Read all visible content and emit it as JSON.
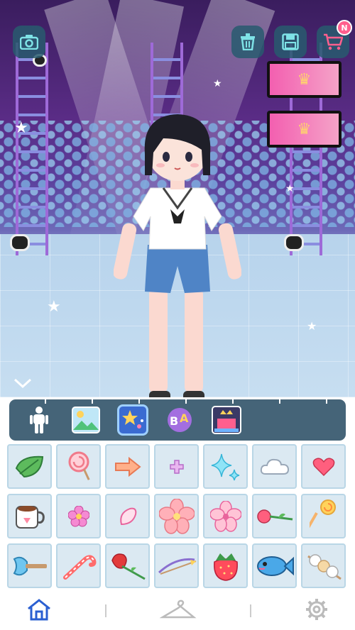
{
  "topbar": {
    "camera_icon": "camera-icon",
    "trash_icon": "trash-icon",
    "save_icon": "floppy-disk-icon",
    "cart_icon": "shopping-cart-icon",
    "cart_badge": "N"
  },
  "categories": [
    {
      "name": "body",
      "icon": "person-icon",
      "selected": false
    },
    {
      "name": "background",
      "icon": "landscape-icon",
      "selected": false
    },
    {
      "name": "stickers",
      "icon": "star-sparkle-icon",
      "selected": true
    },
    {
      "name": "text",
      "icon": "letters-icon",
      "selected": false
    },
    {
      "name": "stage",
      "icon": "stage-frame-icon",
      "selected": false
    }
  ],
  "items": [
    "green-leaf-icon",
    "lollipop-swirl-icon",
    "arrow-right-icon",
    "small-plus-sparkle-icon",
    "blue-sparkle-icon",
    "cloud-icon",
    "heart-icon",
    "cup-icon",
    "pink-flower-icon",
    "petal-icon",
    "cherry-blossom-icon",
    "sakura-flower-icon",
    "rose-icon",
    "candy-wand-icon",
    "blue-axe-icon",
    "candy-cane-icon",
    "red-rose-icon",
    "bow-arrow-icon",
    "strawberry-icon",
    "fish-icon",
    "dango-skewer-icon"
  ],
  "nav": {
    "home_icon": "home-icon",
    "wardrobe_icon": "hanger-icon",
    "settings_icon": "gear-icon"
  },
  "colors": {
    "accent": "#3a6bd1",
    "category_bar": "#456478",
    "cell_bg": "#dbe9f2"
  }
}
